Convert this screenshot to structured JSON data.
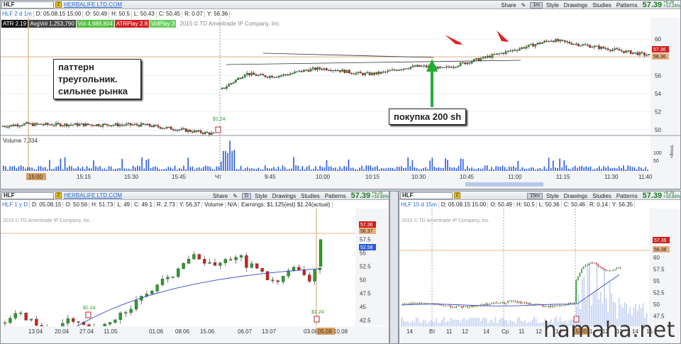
{
  "top": {
    "symbol": "HLF",
    "link_badge": "2",
    "company": "HERBALIFE LTD.COM",
    "toolbar": {
      "share": "Share",
      "scale": "1m",
      "style": "Style",
      "drawings": "Drawings",
      "studies": "Studies",
      "patterns": "Patterns"
    },
    "last_price": "57.39",
    "change": "+6.26",
    "change_pct": "+12.24%",
    "info": [
      "HLF 2 d 1m",
      "D: 05.08.15 15:00",
      "O: 50.49",
      "H: 50.5",
      "L: 50.43",
      "C: 50.45",
      "R: 0.07",
      "Y: 56.36"
    ],
    "indicators": [
      {
        "text": "ATR 2.19",
        "bg": "#111111",
        "fg": "#ffffff"
      },
      {
        "text": "AvgVol 1,253,790",
        "bg": "#444444",
        "fg": "#ffffff"
      },
      {
        "text": "Vol 4,988,804",
        "bg": "#55c040",
        "fg": "#ffffff"
      },
      {
        "text": "ATRPlay 2.8",
        "bg": "#d02020",
        "fg": "#ffffff"
      },
      {
        "text": "VolPlay 3",
        "bg": "#6ad060",
        "fg": "#ffffff"
      }
    ],
    "copyright": "2015 © TD Ameritrade IP Company, Inc.",
    "price_ticks": [
      "60",
      "58",
      "56",
      "54",
      "52",
      "50"
    ],
    "label_y": "56.36",
    "label_c": "57.36",
    "earnings_label": "$1.24",
    "volume_label": "Volume",
    "volume_value": "7,334",
    "vol_ticks": [
      "100",
      "50"
    ],
    "vol_unit": "<thous.",
    "time_ticks": [
      "15:00",
      "15:15",
      "15:30",
      "15:45",
      "Чт",
      "9:45",
      "10:00",
      "10:15",
      "10:30",
      "10:45",
      "11:00",
      "11:15",
      "11:30",
      "11:40"
    ],
    "note_pattern": "паттерн треугольник. сильнее рынка",
    "note_buy": "покупка 200 sh"
  },
  "left": {
    "symbol": "HLF",
    "link_badge": "2",
    "company": "HERBALIFE LTD.COM",
    "toolbar": {
      "share": "Share",
      "scale": "D",
      "style": "Style",
      "drawings": "Drawings",
      "studies": "Studies",
      "patterns": "Patterns"
    },
    "last_price": "57.39",
    "change": "+8.29",
    "change_pct": "+16.88%",
    "info": [
      "HLF 1 y D",
      "D: 05.08.15",
      "O: 50.56",
      "H: 51.73",
      "L: 49",
      "C: 49.1",
      "R: 2.73",
      "Y: 56.37",
      "Volume",
      "N/A",
      "Earnings: $1.125(est) $1.24(actual)"
    ],
    "copyright": "2015 © TD Ameritrade IP Company, Inc.",
    "price_ticks": [
      "60",
      "57.5",
      "55",
      "52.5",
      "50",
      "47.5",
      "45",
      "42.5",
      "40"
    ],
    "labels": [
      "57.36",
      "56.37",
      "52.58"
    ],
    "earn_left": "$1.24",
    "earn_right": "$1.24",
    "time_ticks": [
      "13.04",
      "20.04",
      "27.04",
      "11.05",
      "01.06",
      "08.06",
      "15.06",
      "06.07",
      "13.07",
      "03.08",
      "05.08",
      "10.08"
    ]
  },
  "right": {
    "symbol": "HLF",
    "link_badge": "2",
    "toolbar": {
      "scale": "15m",
      "style": "Style",
      "drawings": "Drawings",
      "studies": "Studies",
      "patterns": "Patterns"
    },
    "last_price": "57.39",
    "change": "+8.29",
    "change_pct": "+16.88%",
    "info": [
      "HLF 15 d 15m",
      "D: 05.08.15 15:00",
      "O: 50.49",
      "H: 50.5",
      "L: 50.36",
      "C: 50.46",
      "R: 0.14",
      "Y: 56.35"
    ],
    "copyright": "2015 © TD Ameritrade IP Company, Inc.",
    "price_ticks": [
      "60",
      "57.5",
      "55",
      "52.5",
      "50",
      "47.5",
      "45",
      "42.5",
      "40"
    ],
    "labels": [
      "57.36",
      "56.36"
    ],
    "time_ticks": [
      "14",
      "Вт",
      "11",
      "12",
      "14",
      "Ср",
      "11",
      "12",
      "14",
      "15:00",
      "11",
      "12",
      "13",
      "14",
      "15"
    ]
  },
  "watermark": "hamaha.net"
}
